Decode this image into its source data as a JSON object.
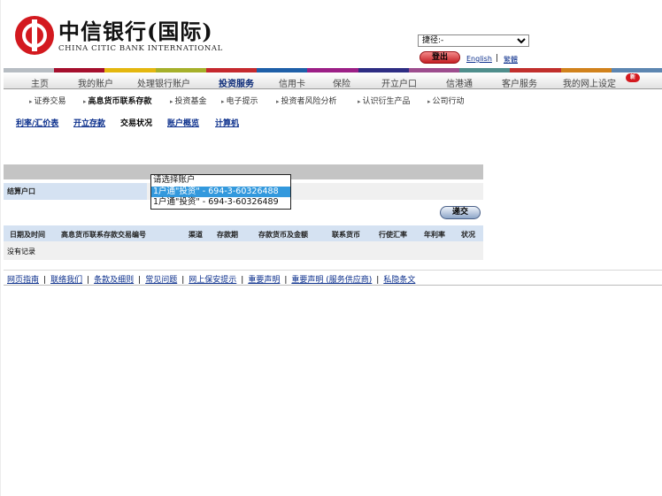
{
  "brand": {
    "name_cn": "中信银行(国际)",
    "name_en": "CHINA CITIC BANK INTERNATIONAL"
  },
  "shortcut": {
    "selected": "捷径:-"
  },
  "header": {
    "logout": "登出",
    "english": "English",
    "separator": "|",
    "traditional": "繁體"
  },
  "colors": {
    "strip": [
      "#b7bdc3",
      "#a50f2d",
      "#e4b70f",
      "#a6b02a",
      "#c5292e",
      "#1e5fa8",
      "#9c1f86",
      "#2e2d83",
      "#9d4d8e",
      "#4f8e8c",
      "#c12f2c",
      "#d1821c",
      "#5d86b1"
    ],
    "brand_red": "#d3191f",
    "link_blue": "#0b2f8c"
  },
  "nav": {
    "items": [
      "主页",
      "我的账户",
      "处理银行账户",
      "投资服务",
      "信用卡",
      "保险",
      "开立户口",
      "信港通",
      "客户服务",
      "我的网上设定"
    ],
    "active": "投资服务",
    "badge": "新"
  },
  "subnav": {
    "items": [
      "证券交易",
      "高息货币联系存款",
      "投资基金",
      "电子提示",
      "投资者风险分析",
      "认识衍生产品",
      "公司行动"
    ],
    "active": "高息货币联系存款"
  },
  "tools": {
    "items": [
      "利率/汇价表",
      "开立存款",
      "交易状况",
      "账户概览",
      "计算机"
    ],
    "active": "交易状况"
  },
  "form": {
    "settlement_label": "结算户口",
    "options": [
      "请选择账户",
      "1户通\"投资\" - 694-3-60326488",
      "1户通\"投资\" - 694-3-60326489"
    ],
    "selected_option": "1户通\"投资\" - 694-3-60326488",
    "submit": "递交"
  },
  "table": {
    "headers": [
      "日期及时间",
      "高息货币联系存款交易编号",
      "渠道",
      "存款期",
      "存款货币及金额",
      "联系货币",
      "行使汇率",
      "年利率",
      "状况"
    ],
    "empty": "没有记录"
  },
  "footer": {
    "links": [
      "网页指南",
      "联络我们",
      "条款及细则",
      "常见问题",
      "网上保安提示",
      "重要声明",
      "重要声明 (服务供应商)",
      "私隐条文"
    ],
    "separator": "|"
  }
}
